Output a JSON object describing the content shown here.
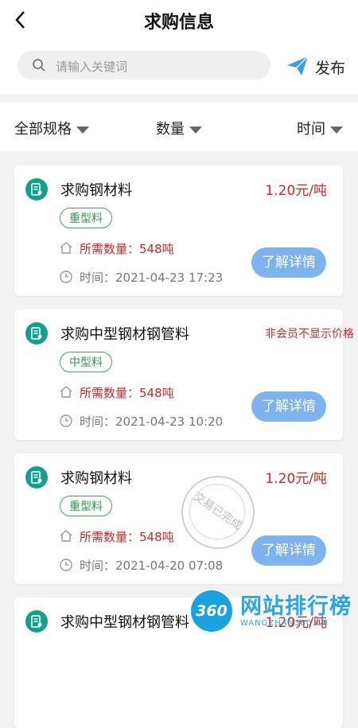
{
  "header": {
    "title": "求购信息",
    "back_icon": "chevron-left-icon"
  },
  "search": {
    "placeholder": "请输入关键词",
    "publish_label": "发布"
  },
  "filters": [
    {
      "label": "全部规格"
    },
    {
      "label": "数量"
    },
    {
      "label": "时间"
    }
  ],
  "cards": [
    {
      "title": "求购钢材料",
      "price": "1.20元/吨",
      "tag": "重型料",
      "quantity": "所需数量：548吨",
      "time": "时间：2021-04-23 17:23",
      "button": "了解详情"
    },
    {
      "title": "求购中型钢材钢管料",
      "price": "非会员不显示价格",
      "tag": "中型料",
      "quantity": "所需数量：548吨",
      "time": "时间：2021-04-23 10:20",
      "button": "了解详情"
    },
    {
      "title": "求购钢材料",
      "price": "1.20元/吨",
      "tag": "重型料",
      "quantity": "所需数量：548吨",
      "time": "时间：2021-04-20 07:08",
      "button": "了解详情",
      "stamp": "交易已完成"
    },
    {
      "title": "求购中型钢材钢管料",
      "price": "1.20元/吨"
    }
  ],
  "watermark": {
    "logo": "360",
    "name": "网站排行榜",
    "sub": "WANGZHAN360.CN"
  },
  "colors": {
    "accent_green": "#11a08d",
    "price_red": "#c62828",
    "button_blue": "#7db4ef",
    "tag_green": "#2f9a4f"
  }
}
